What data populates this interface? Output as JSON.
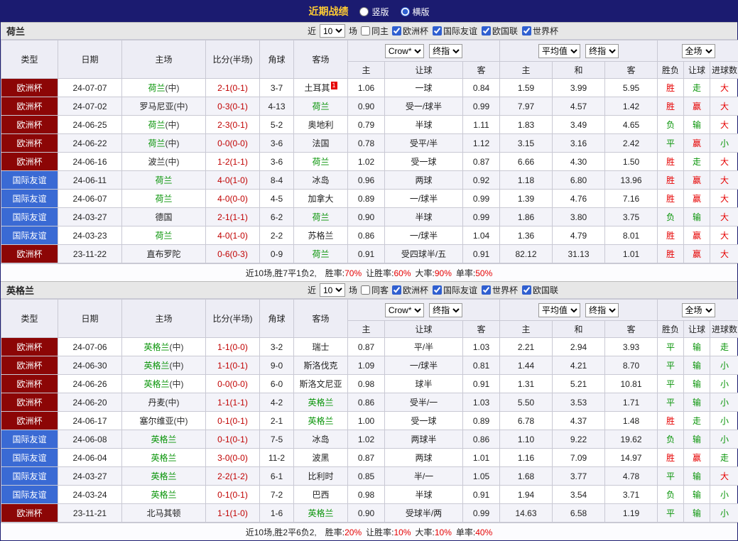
{
  "colors": {
    "topbar_bg": "#1b1b70",
    "title_gold": "#ffcc33",
    "euro_cup_red": "#8c0606",
    "friendly_blue": "#3a6ad4",
    "team_green": "#089408",
    "score_red": "#c00000",
    "stat_red": "#e60000"
  },
  "top_bar": {
    "title": "近期战绩",
    "radios": [
      {
        "label": "竖版",
        "selected": false
      },
      {
        "label": "横版",
        "selected": true
      }
    ]
  },
  "sections": [
    {
      "team": "荷兰",
      "filter": {
        "near": "近",
        "count": "10",
        "games": "场",
        "same": {
          "label": "同主",
          "checked": false
        },
        "leagues": [
          {
            "label": "欧洲杯",
            "checked": true
          },
          {
            "label": "国际友谊",
            "checked": true
          },
          {
            "label": "欧国联",
            "checked": true
          },
          {
            "label": "世界杯",
            "checked": true
          }
        ]
      },
      "header": {
        "cols": [
          "类型",
          "日期",
          "主场",
          "比分(半场)",
          "角球",
          "客场"
        ],
        "odds_selects": [
          "Crow*",
          "终指"
        ],
        "avg_selects": [
          "平均值",
          "终指"
        ],
        "scope_select": "全场",
        "sub": [
          "主",
          "让球",
          "客",
          "主",
          "和",
          "客",
          "胜负",
          "让球",
          "进球数"
        ]
      },
      "rows": [
        {
          "type": "欧洲杯",
          "style": "cup",
          "date": "24-07-07",
          "home": "荷兰",
          "home_suffix": "(中)",
          "home_green": true,
          "score": "2-1(0-1)",
          "corner": "3-7",
          "away": "土耳其",
          "away_green": false,
          "away_badge": "1",
          "o1": "1.06",
          "handicap": "一球",
          "o2": "0.84",
          "a1": "1.59",
          "a2": "3.99",
          "a3": "5.95",
          "r1": "胜",
          "r1c": "red",
          "r2": "走",
          "r2c": "green",
          "r3": "大",
          "r3c": "red"
        },
        {
          "type": "欧洲杯",
          "style": "cup",
          "date": "24-07-02",
          "home": "罗马尼亚",
          "home_suffix": "(中)",
          "home_green": false,
          "score": "0-3(0-1)",
          "corner": "4-13",
          "away": "荷兰",
          "away_green": true,
          "o1": "0.90",
          "handicap": "受一/球半",
          "o2": "0.99",
          "a1": "7.97",
          "a2": "4.57",
          "a3": "1.42",
          "r1": "胜",
          "r1c": "red",
          "r2": "赢",
          "r2c": "red",
          "r3": "大",
          "r3c": "red"
        },
        {
          "type": "欧洲杯",
          "style": "cup",
          "date": "24-06-25",
          "home": "荷兰",
          "home_suffix": "(中)",
          "home_green": true,
          "score": "2-3(0-1)",
          "corner": "5-2",
          "away": "奥地利",
          "away_green": false,
          "o1": "0.79",
          "handicap": "半球",
          "o2": "1.11",
          "a1": "1.83",
          "a2": "3.49",
          "a3": "4.65",
          "r1": "负",
          "r1c": "green",
          "r2": "输",
          "r2c": "green",
          "r3": "大",
          "r3c": "red"
        },
        {
          "type": "欧洲杯",
          "style": "cup",
          "date": "24-06-22",
          "home": "荷兰",
          "home_suffix": "(中)",
          "home_green": true,
          "score": "0-0(0-0)",
          "corner": "3-6",
          "away": "法国",
          "away_green": false,
          "o1": "0.78",
          "handicap": "受平/半",
          "o2": "1.12",
          "a1": "3.15",
          "a2": "3.16",
          "a3": "2.42",
          "r1": "平",
          "r1c": "green",
          "r2": "赢",
          "r2c": "red",
          "r3": "小",
          "r3c": "green"
        },
        {
          "type": "欧洲杯",
          "style": "cup",
          "date": "24-06-16",
          "home": "波兰",
          "home_suffix": "(中)",
          "home_green": false,
          "score": "1-2(1-1)",
          "corner": "3-6",
          "away": "荷兰",
          "away_green": true,
          "o1": "1.02",
          "handicap": "受一球",
          "o2": "0.87",
          "a1": "6.66",
          "a2": "4.30",
          "a3": "1.50",
          "r1": "胜",
          "r1c": "red",
          "r2": "走",
          "r2c": "green",
          "r3": "大",
          "r3c": "red"
        },
        {
          "type": "国际友谊",
          "style": "friendly",
          "date": "24-06-11",
          "home": "荷兰",
          "home_suffix": "",
          "home_green": true,
          "score": "4-0(1-0)",
          "corner": "8-4",
          "away": "冰岛",
          "away_green": false,
          "o1": "0.96",
          "handicap": "两球",
          "o2": "0.92",
          "a1": "1.18",
          "a2": "6.80",
          "a3": "13.96",
          "r1": "胜",
          "r1c": "red",
          "r2": "赢",
          "r2c": "red",
          "r3": "大",
          "r3c": "red"
        },
        {
          "type": "国际友谊",
          "style": "friendly",
          "date": "24-06-07",
          "home": "荷兰",
          "home_suffix": "",
          "home_green": true,
          "score": "4-0(0-0)",
          "corner": "4-5",
          "away": "加拿大",
          "away_green": false,
          "o1": "0.89",
          "handicap": "一/球半",
          "o2": "0.99",
          "a1": "1.39",
          "a2": "4.76",
          "a3": "7.16",
          "r1": "胜",
          "r1c": "red",
          "r2": "赢",
          "r2c": "red",
          "r3": "大",
          "r3c": "red"
        },
        {
          "type": "国际友谊",
          "style": "friendly",
          "date": "24-03-27",
          "home": "德国",
          "home_suffix": "",
          "home_green": false,
          "score": "2-1(1-1)",
          "corner": "6-2",
          "away": "荷兰",
          "away_green": true,
          "o1": "0.90",
          "handicap": "半球",
          "o2": "0.99",
          "a1": "1.86",
          "a2": "3.80",
          "a3": "3.75",
          "r1": "负",
          "r1c": "green",
          "r2": "输",
          "r2c": "green",
          "r3": "大",
          "r3c": "red"
        },
        {
          "type": "国际友谊",
          "style": "friendly",
          "date": "24-03-23",
          "home": "荷兰",
          "home_suffix": "",
          "home_green": true,
          "score": "4-0(1-0)",
          "corner": "2-2",
          "away": "苏格兰",
          "away_green": false,
          "o1": "0.86",
          "handicap": "一/球半",
          "o2": "1.04",
          "a1": "1.36",
          "a2": "4.79",
          "a3": "8.01",
          "r1": "胜",
          "r1c": "red",
          "r2": "赢",
          "r2c": "red",
          "r3": "大",
          "r3c": "red"
        },
        {
          "type": "欧洲杯",
          "style": "cup",
          "date": "23-11-22",
          "home": "直布罗陀",
          "home_suffix": "",
          "home_green": false,
          "score": "0-6(0-3)",
          "corner": "0-9",
          "away": "荷兰",
          "away_green": true,
          "o1": "0.91",
          "handicap": "受四球半/五",
          "o2": "0.91",
          "a1": "82.12",
          "a2": "31.13",
          "a3": "1.01",
          "r1": "胜",
          "r1c": "red",
          "r2": "赢",
          "r2c": "red",
          "r3": "大",
          "r3c": "red"
        }
      ],
      "summary": {
        "prefix": "近10场,胜7平1负2,",
        "stats": [
          {
            "label": "胜率:",
            "value": "70%"
          },
          {
            "label": "让胜率:",
            "value": "60%"
          },
          {
            "label": "大率:",
            "value": "90%"
          },
          {
            "label": "单率:",
            "value": "50%"
          }
        ]
      }
    },
    {
      "team": "英格兰",
      "filter": {
        "near": "近",
        "count": "10",
        "games": "场",
        "same": {
          "label": "同客",
          "checked": false
        },
        "leagues": [
          {
            "label": "欧洲杯",
            "checked": true
          },
          {
            "label": "国际友谊",
            "checked": true
          },
          {
            "label": "世界杯",
            "checked": true
          },
          {
            "label": "欧国联",
            "checked": true
          }
        ]
      },
      "header": {
        "cols": [
          "类型",
          "日期",
          "主场",
          "比分(半场)",
          "角球",
          "客场"
        ],
        "odds_selects": [
          "Crow*",
          "终指"
        ],
        "avg_selects": [
          "平均值",
          "终指"
        ],
        "scope_select": "全场",
        "sub": [
          "主",
          "让球",
          "客",
          "主",
          "和",
          "客",
          "胜负",
          "让球",
          "进球数"
        ]
      },
      "rows": [
        {
          "type": "欧洲杯",
          "style": "cup",
          "date": "24-07-06",
          "home": "英格兰",
          "home_suffix": "(中)",
          "home_green": true,
          "score": "1-1(0-0)",
          "corner": "3-2",
          "away": "瑞士",
          "away_green": false,
          "o1": "0.87",
          "handicap": "平/半",
          "o2": "1.03",
          "a1": "2.21",
          "a2": "2.94",
          "a3": "3.93",
          "r1": "平",
          "r1c": "green",
          "r2": "输",
          "r2c": "green",
          "r3": "走",
          "r3c": "green"
        },
        {
          "type": "欧洲杯",
          "style": "cup",
          "date": "24-06-30",
          "home": "英格兰",
          "home_suffix": "(中)",
          "home_green": true,
          "score": "1-1(0-1)",
          "corner": "9-0",
          "away": "斯洛伐克",
          "away_green": false,
          "o1": "1.09",
          "handicap": "一/球半",
          "o2": "0.81",
          "a1": "1.44",
          "a2": "4.21",
          "a3": "8.70",
          "r1": "平",
          "r1c": "green",
          "r2": "输",
          "r2c": "green",
          "r3": "小",
          "r3c": "green"
        },
        {
          "type": "欧洲杯",
          "style": "cup",
          "date": "24-06-26",
          "home": "英格兰",
          "home_suffix": "(中)",
          "home_green": true,
          "score": "0-0(0-0)",
          "corner": "6-0",
          "away": "斯洛文尼亚",
          "away_green": false,
          "o1": "0.98",
          "handicap": "球半",
          "o2": "0.91",
          "a1": "1.31",
          "a2": "5.21",
          "a3": "10.81",
          "r1": "平",
          "r1c": "green",
          "r2": "输",
          "r2c": "green",
          "r3": "小",
          "r3c": "green"
        },
        {
          "type": "欧洲杯",
          "style": "cup",
          "date": "24-06-20",
          "home": "丹麦",
          "home_suffix": "(中)",
          "home_green": false,
          "score": "1-1(1-1)",
          "corner": "4-2",
          "away": "英格兰",
          "away_green": true,
          "o1": "0.86",
          "handicap": "受半/一",
          "o2": "1.03",
          "a1": "5.50",
          "a2": "3.53",
          "a3": "1.71",
          "r1": "平",
          "r1c": "green",
          "r2": "输",
          "r2c": "green",
          "r3": "小",
          "r3c": "green"
        },
        {
          "type": "欧洲杯",
          "style": "cup",
          "date": "24-06-17",
          "home": "塞尔维亚",
          "home_suffix": "(中)",
          "home_green": false,
          "score": "0-1(0-1)",
          "corner": "2-1",
          "away": "英格兰",
          "away_green": true,
          "o1": "1.00",
          "handicap": "受一球",
          "o2": "0.89",
          "a1": "6.78",
          "a2": "4.37",
          "a3": "1.48",
          "r1": "胜",
          "r1c": "red",
          "r2": "走",
          "r2c": "green",
          "r3": "小",
          "r3c": "green"
        },
        {
          "type": "国际友谊",
          "style": "friendly",
          "date": "24-06-08",
          "home": "英格兰",
          "home_suffix": "",
          "home_green": true,
          "score": "0-1(0-1)",
          "corner": "7-5",
          "away": "冰岛",
          "away_green": false,
          "o1": "1.02",
          "handicap": "两球半",
          "o2": "0.86",
          "a1": "1.10",
          "a2": "9.22",
          "a3": "19.62",
          "r1": "负",
          "r1c": "green",
          "r2": "输",
          "r2c": "green",
          "r3": "小",
          "r3c": "green"
        },
        {
          "type": "国际友谊",
          "style": "friendly",
          "date": "24-06-04",
          "home": "英格兰",
          "home_suffix": "",
          "home_green": true,
          "score": "3-0(0-0)",
          "corner": "11-2",
          "away": "波黑",
          "away_green": false,
          "o1": "0.87",
          "handicap": "两球",
          "o2": "1.01",
          "a1": "1.16",
          "a2": "7.09",
          "a3": "14.97",
          "r1": "胜",
          "r1c": "red",
          "r2": "赢",
          "r2c": "red",
          "r3": "走",
          "r3c": "green"
        },
        {
          "type": "国际友谊",
          "style": "friendly",
          "date": "24-03-27",
          "home": "英格兰",
          "home_suffix": "",
          "home_green": true,
          "score": "2-2(1-2)",
          "corner": "6-1",
          "away": "比利时",
          "away_green": false,
          "o1": "0.85",
          "handicap": "半/一",
          "o2": "1.05",
          "a1": "1.68",
          "a2": "3.77",
          "a3": "4.78",
          "r1": "平",
          "r1c": "green",
          "r2": "输",
          "r2c": "green",
          "r3": "大",
          "r3c": "red"
        },
        {
          "type": "国际友谊",
          "style": "friendly",
          "date": "24-03-24",
          "home": "英格兰",
          "home_suffix": "",
          "home_green": true,
          "score": "0-1(0-1)",
          "corner": "7-2",
          "away": "巴西",
          "away_green": false,
          "o1": "0.98",
          "handicap": "半球",
          "o2": "0.91",
          "a1": "1.94",
          "a2": "3.54",
          "a3": "3.71",
          "r1": "负",
          "r1c": "green",
          "r2": "输",
          "r2c": "green",
          "r3": "小",
          "r3c": "green"
        },
        {
          "type": "欧洲杯",
          "style": "cup",
          "date": "23-11-21",
          "home": "北马其顿",
          "home_suffix": "",
          "home_green": false,
          "score": "1-1(1-0)",
          "corner": "1-6",
          "away": "英格兰",
          "away_green": true,
          "o1": "0.90",
          "handicap": "受球半/两",
          "o2": "0.99",
          "a1": "14.63",
          "a2": "6.58",
          "a3": "1.19",
          "r1": "平",
          "r1c": "green",
          "r2": "输",
          "r2c": "green",
          "r3": "小",
          "r3c": "green"
        }
      ],
      "summary": {
        "prefix": "近10场,胜2平6负2,",
        "stats": [
          {
            "label": "胜率:",
            "value": "20%"
          },
          {
            "label": "让胜率:",
            "value": "10%"
          },
          {
            "label": "大率:",
            "value": "10%"
          },
          {
            "label": "单率:",
            "value": "40%"
          }
        ]
      }
    }
  ]
}
